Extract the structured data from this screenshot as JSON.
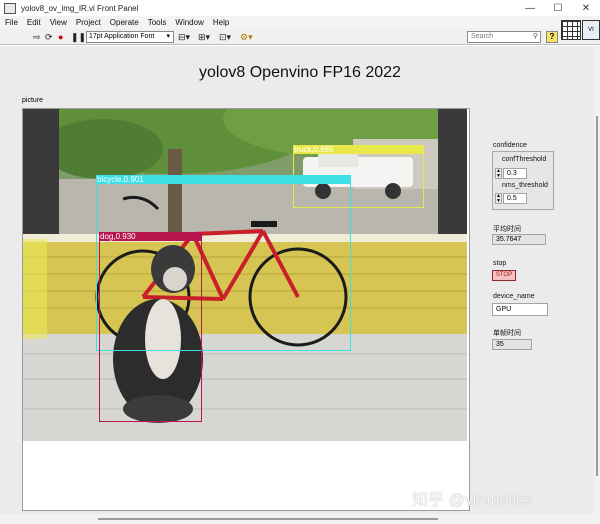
{
  "window": {
    "title": "yolov8_ov_img_IR.vi Front Panel",
    "minimize": "—",
    "maximize": "☐",
    "close": "✕"
  },
  "menu": [
    "File",
    "Edit",
    "View",
    "Project",
    "Operate",
    "Tools",
    "Window",
    "Help"
  ],
  "toolbar": {
    "font": "17pt Application Font",
    "search_placeholder": "Search",
    "help": "?"
  },
  "panel": {
    "title": "yolov8 Openvino FP16 2022",
    "picture_label": "picture",
    "detections": [
      {
        "label": "truck,0.685",
        "color": "#e8e84a"
      },
      {
        "label": "bicycle,0.901",
        "color": "#3ee0e6"
      },
      {
        "label": "dog,0.930",
        "color": "#b8154e"
      }
    ]
  },
  "controls": {
    "confidence_label": "confidence",
    "conf_threshold_label": "confThreshold",
    "conf_threshold_value": "0.3",
    "nms_threshold_label": "nms_threshold",
    "nms_threshold_value": "0.5",
    "avg_time_label": "平均时间",
    "avg_time_value": "35.7647",
    "stop_label": "stop",
    "stop_button": "STOP",
    "device_label": "device_name",
    "device_value": "GPU",
    "single_time_label": "单帧时间",
    "single_time_value": "35"
  },
  "watermark": "知乎 @virobotics"
}
